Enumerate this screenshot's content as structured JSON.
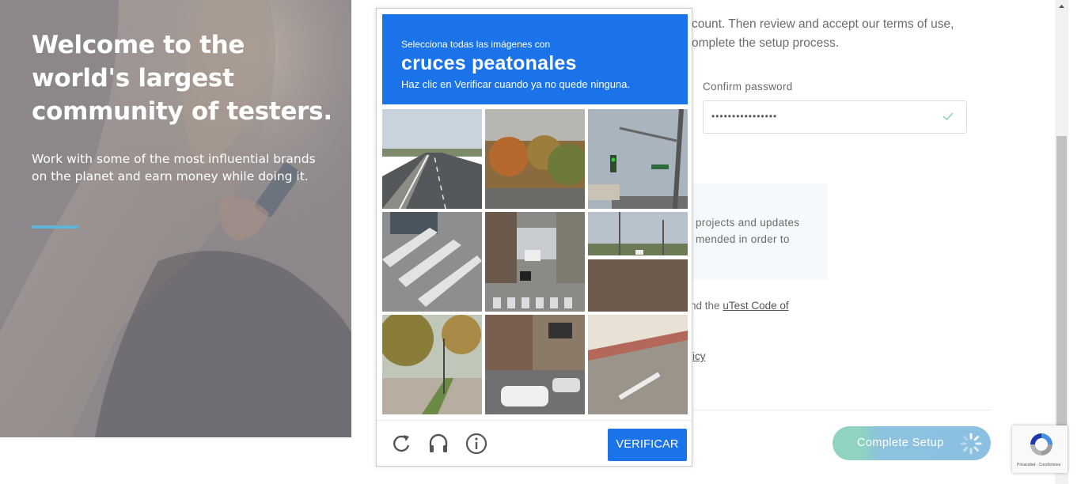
{
  "hero": {
    "title": "Welcome to the world's largest community of testers.",
    "subtitle": "Work with some of the most influential brands on the planet and earn money while doing it."
  },
  "form": {
    "intro_line1": "count. Then review and accept our terms of use,",
    "intro_line2": "omplete the setup process.",
    "confirm_password_label": "Confirm password",
    "confirm_password_value": "••••••••••••••••",
    "notice_line1": "projects and updates",
    "notice_line2": "mended in order to",
    "terms_prefix": "nd the",
    "terms_link": "uTest Code of",
    "privacy_fragment": "icy",
    "complete_button": "Complete Setup"
  },
  "captcha": {
    "instruction_small": "Selecciona todas las imágenes con",
    "target": "cruces peatonales",
    "hint": "Haz clic en Verificar cuando ya no quede ninguna.",
    "verify_button": "VERIFICAR",
    "footer_icons": [
      "reload-icon",
      "audio-headphones-icon",
      "info-icon"
    ],
    "tiles": [
      {
        "scene": "highway-road"
      },
      {
        "scene": "trees-autumn"
      },
      {
        "scene": "traffic-light-pole"
      },
      {
        "scene": "crosswalk-close"
      },
      {
        "scene": "city-street-crosswalk-motorcycle"
      },
      {
        "scene": "wide-avenue"
      },
      {
        "scene": "sidewalk-trees"
      },
      {
        "scene": "downtown-taxi"
      },
      {
        "scene": "pavement-barrier"
      }
    ]
  },
  "badge": {
    "text": "Privacidad - Condiciones"
  },
  "colors": {
    "captcha_blue": "#1a73e8",
    "hero_rule": "#5fb6d9",
    "check_green": "#8fd3c0"
  }
}
